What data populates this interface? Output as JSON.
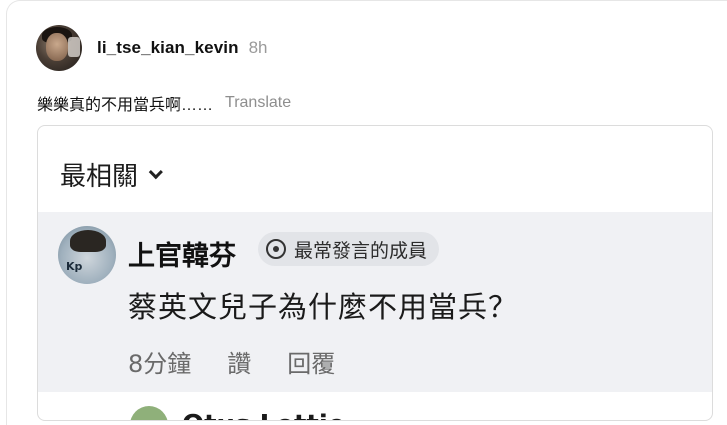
{
  "post": {
    "username": "li_tse_kian_kevin",
    "time": "8h",
    "caption": "樂樂真的不用當兵啊……",
    "translate_label": "Translate"
  },
  "embed": {
    "sort_label": "最相關",
    "comment": {
      "author": "上官韓芬",
      "badge": "最常發言的成員",
      "avatar_text": "Kp",
      "text": "蔡英文兒子為什麼不用當兵？",
      "time": "8分鐘",
      "like_label": "讚",
      "reply_label": "回覆"
    },
    "next_comment": {
      "author": "Otus Lottie"
    }
  },
  "colors": {
    "comment_bg": "#f0f1f4",
    "badge_bg": "#e2e4e8",
    "muted_text": "#8e8e8e"
  }
}
